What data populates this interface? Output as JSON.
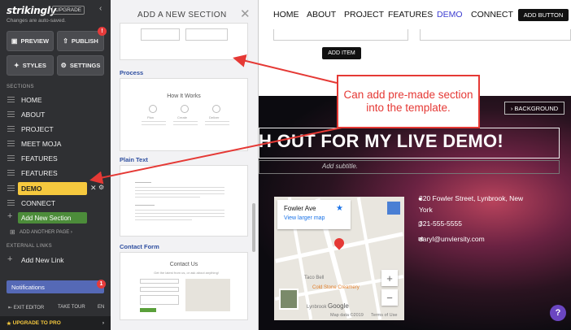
{
  "sidebar": {
    "logo": "strikingly",
    "upgrade_label": "UPGRADE",
    "autosave_text": "Changes are auto-saved.",
    "preview_label": "PREVIEW",
    "publish_label": "PUBLISH",
    "publish_badge": "!",
    "styles_label": "STYLES",
    "settings_label": "SETTINGS",
    "sections_heading": "SECTIONS",
    "items": [
      "HOME",
      "ABOUT",
      "PROJECT",
      "MEET MOJA",
      "FEATURES",
      "FEATURES",
      "DEMO",
      "CONNECT"
    ],
    "add_section_label": "Add New Section",
    "add_page_label": "ADD ANOTHER PAGE ›",
    "external_heading": "EXTERNAL LINKS",
    "add_link_label": "Add New Link",
    "notifications_label": "Notifications",
    "notifications_badge": "1",
    "exit_label": "EXIT EDITOR",
    "tour_label": "TAKE TOUR",
    "lang_label": "EN",
    "upgrade_pro_label": "UPGRADE TO PRO"
  },
  "panel": {
    "title": "ADD A NEW SECTION",
    "sections": [
      {
        "caption": "Process",
        "thumb_title": "How It Works"
      },
      {
        "caption": "Plain Text",
        "thumb_title": ""
      },
      {
        "caption": "Contact Form",
        "thumb_title": "Contact Us"
      }
    ],
    "thumb_small": [
      "Process",
      "Plan",
      "Create",
      "Deliver"
    ],
    "contact_sub": "Get the latest from us, or ask about anything!"
  },
  "topnav": {
    "items": [
      "HOME",
      "ABOUT",
      "PROJECT",
      "FEATURES",
      "DEMO",
      "CONNECT"
    ],
    "active": "DEMO",
    "add_button": "ADD BUTTON"
  },
  "add_item_label": "ADD ITEM",
  "hero": {
    "background_label": "BACKGROUND",
    "headline": "H OUT FOR MY LIVE DEMO!",
    "subtitle": "Add subtitle.",
    "address_line1": "320 Fowler Street, Lynbrook, New",
    "address_line2": "York",
    "phone": "321-555-5555",
    "email": "daryl@unviersity.com"
  },
  "map": {
    "place": "Fowler Ave",
    "link": "View larger map",
    "label_creamery": "Cold Stone Creamery",
    "label_bell": "Taco Bell",
    "label_lynbrook": "Lynbrook",
    "copyright": "Map data ©2019",
    "terms": "Terms of Use",
    "google": "Google"
  },
  "callout": "Can add pre-made section into the template.",
  "colors": {
    "accent": "#e53935",
    "demo_highlight": "#f6c93e",
    "add_section": "#4c8c3a",
    "nav_active": "#3c3cd0"
  }
}
